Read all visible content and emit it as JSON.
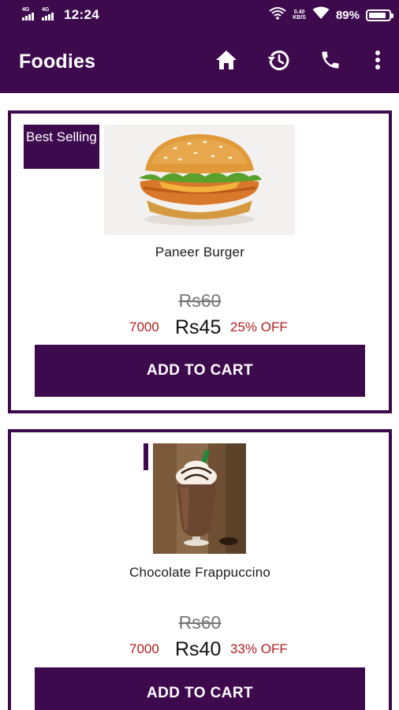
{
  "status_bar": {
    "signal_1_label": "4G",
    "signal_2_label": "4G",
    "time": "12:24",
    "speed_top": "0.40",
    "speed_bottom": "KB/S",
    "battery_text": "89%",
    "battery_level": 0.89
  },
  "app_bar": {
    "title": "Foodies",
    "actions": [
      {
        "icon": "home-icon"
      },
      {
        "icon": "history-icon"
      },
      {
        "icon": "phone-icon"
      },
      {
        "icon": "more-vert-icon"
      }
    ]
  },
  "products": [
    {
      "badge": "Best Selling",
      "image": "paneer-burger-image",
      "name": "Paneer Burger",
      "old_price": "Rs60",
      "code": "7000",
      "price": "Rs45",
      "discount": "25% OFF",
      "button": "ADD TO CART"
    },
    {
      "badge": "",
      "image": "chocolate-frappuccino-image",
      "name": "Chocolate Frappuccino",
      "old_price": "Rs60",
      "code": "7000",
      "price": "Rs40",
      "discount": "33% OFF",
      "button": "ADD TO CART"
    }
  ],
  "colors": {
    "primary": "#3e0a4e",
    "discount_red": "#b02020",
    "old_price_grey": "#777777"
  }
}
